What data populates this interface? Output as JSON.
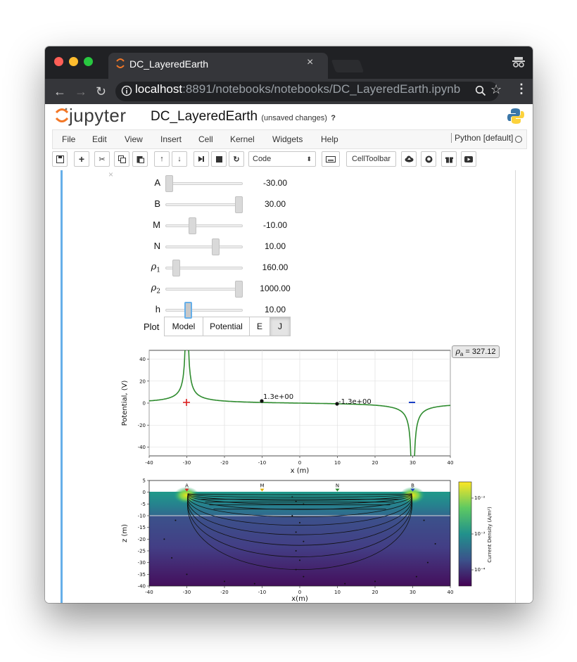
{
  "browser": {
    "tab_title": "DC_LayeredEarth",
    "tab_close": "×",
    "url_host": "localhost",
    "url_rest": ":8891/notebooks/notebooks/DC_LayeredEarth.ipynb",
    "colors": {
      "titlebar": "#202124",
      "toolbar": "#35363a",
      "close": "#ff5f57",
      "minimize": "#febc2e",
      "maximize": "#28c840"
    }
  },
  "jupyter": {
    "logo_text": "jupyter",
    "notebook_name": "DC_LayeredEarth",
    "save_status": "(unsaved changes)",
    "trusted_mark": "?",
    "menu": [
      "File",
      "Edit",
      "View",
      "Insert",
      "Cell",
      "Kernel",
      "Widgets",
      "Help"
    ],
    "kernel_name": "Python [default]",
    "cell_type": "Code",
    "celltoolbar_label": "CellToolbar"
  },
  "widgets": {
    "sliders": [
      {
        "label": "A",
        "value": "-30.00",
        "fraction": 0.0
      },
      {
        "label": "B",
        "value": "30.00",
        "fraction": 1.0
      },
      {
        "label": "M",
        "value": "-10.00",
        "fraction": 0.333
      },
      {
        "label": "N",
        "value": "10.00",
        "fraction": 0.667
      },
      {
        "label": "ρ",
        "sub": "1",
        "value": "160.00",
        "fraction": 0.1
      },
      {
        "label": "ρ",
        "sub": "2",
        "value": "1000.00",
        "fraction": 1.0
      },
      {
        "label": "h",
        "value": "10.00",
        "fraction": 0.27
      }
    ],
    "plot_label": "Plot",
    "plot_options": [
      "Model",
      "Potential",
      "E",
      "J"
    ],
    "plot_selected": "J"
  },
  "plots": {
    "rho_a_label": "ρ",
    "rho_a_sub": "a",
    "rho_a_value": "= 327.12",
    "potential": {
      "ylabel": "Potential, (V)",
      "xlabel": "x (m)",
      "xticks": [
        -40,
        -30,
        -20,
        -10,
        0,
        10,
        20,
        30,
        40
      ],
      "yticks": [
        40,
        20,
        0,
        -20,
        -40
      ],
      "xlim": [
        -40,
        40
      ],
      "ylim": [
        -48,
        48
      ],
      "annotations": [
        "1.3e+00",
        "-1.3e+00"
      ],
      "line_color": "#2e8b2e"
    },
    "current": {
      "ylabel": "z (m)",
      "xlabel": "x(m)",
      "xticks": [
        -40,
        -30,
        -20,
        -10,
        0,
        10,
        20,
        30,
        40
      ],
      "yticks": [
        5,
        0,
        -5,
        -10,
        -15,
        -20,
        -25,
        -30,
        -35,
        -40
      ],
      "electrodes": [
        "A",
        "M",
        "N",
        "B"
      ],
      "colorbar_label": "Current Density (A/m²)",
      "colorbar_ticks": [
        "10⁻²",
        "10⁻³",
        "10⁻⁴"
      ]
    }
  }
}
